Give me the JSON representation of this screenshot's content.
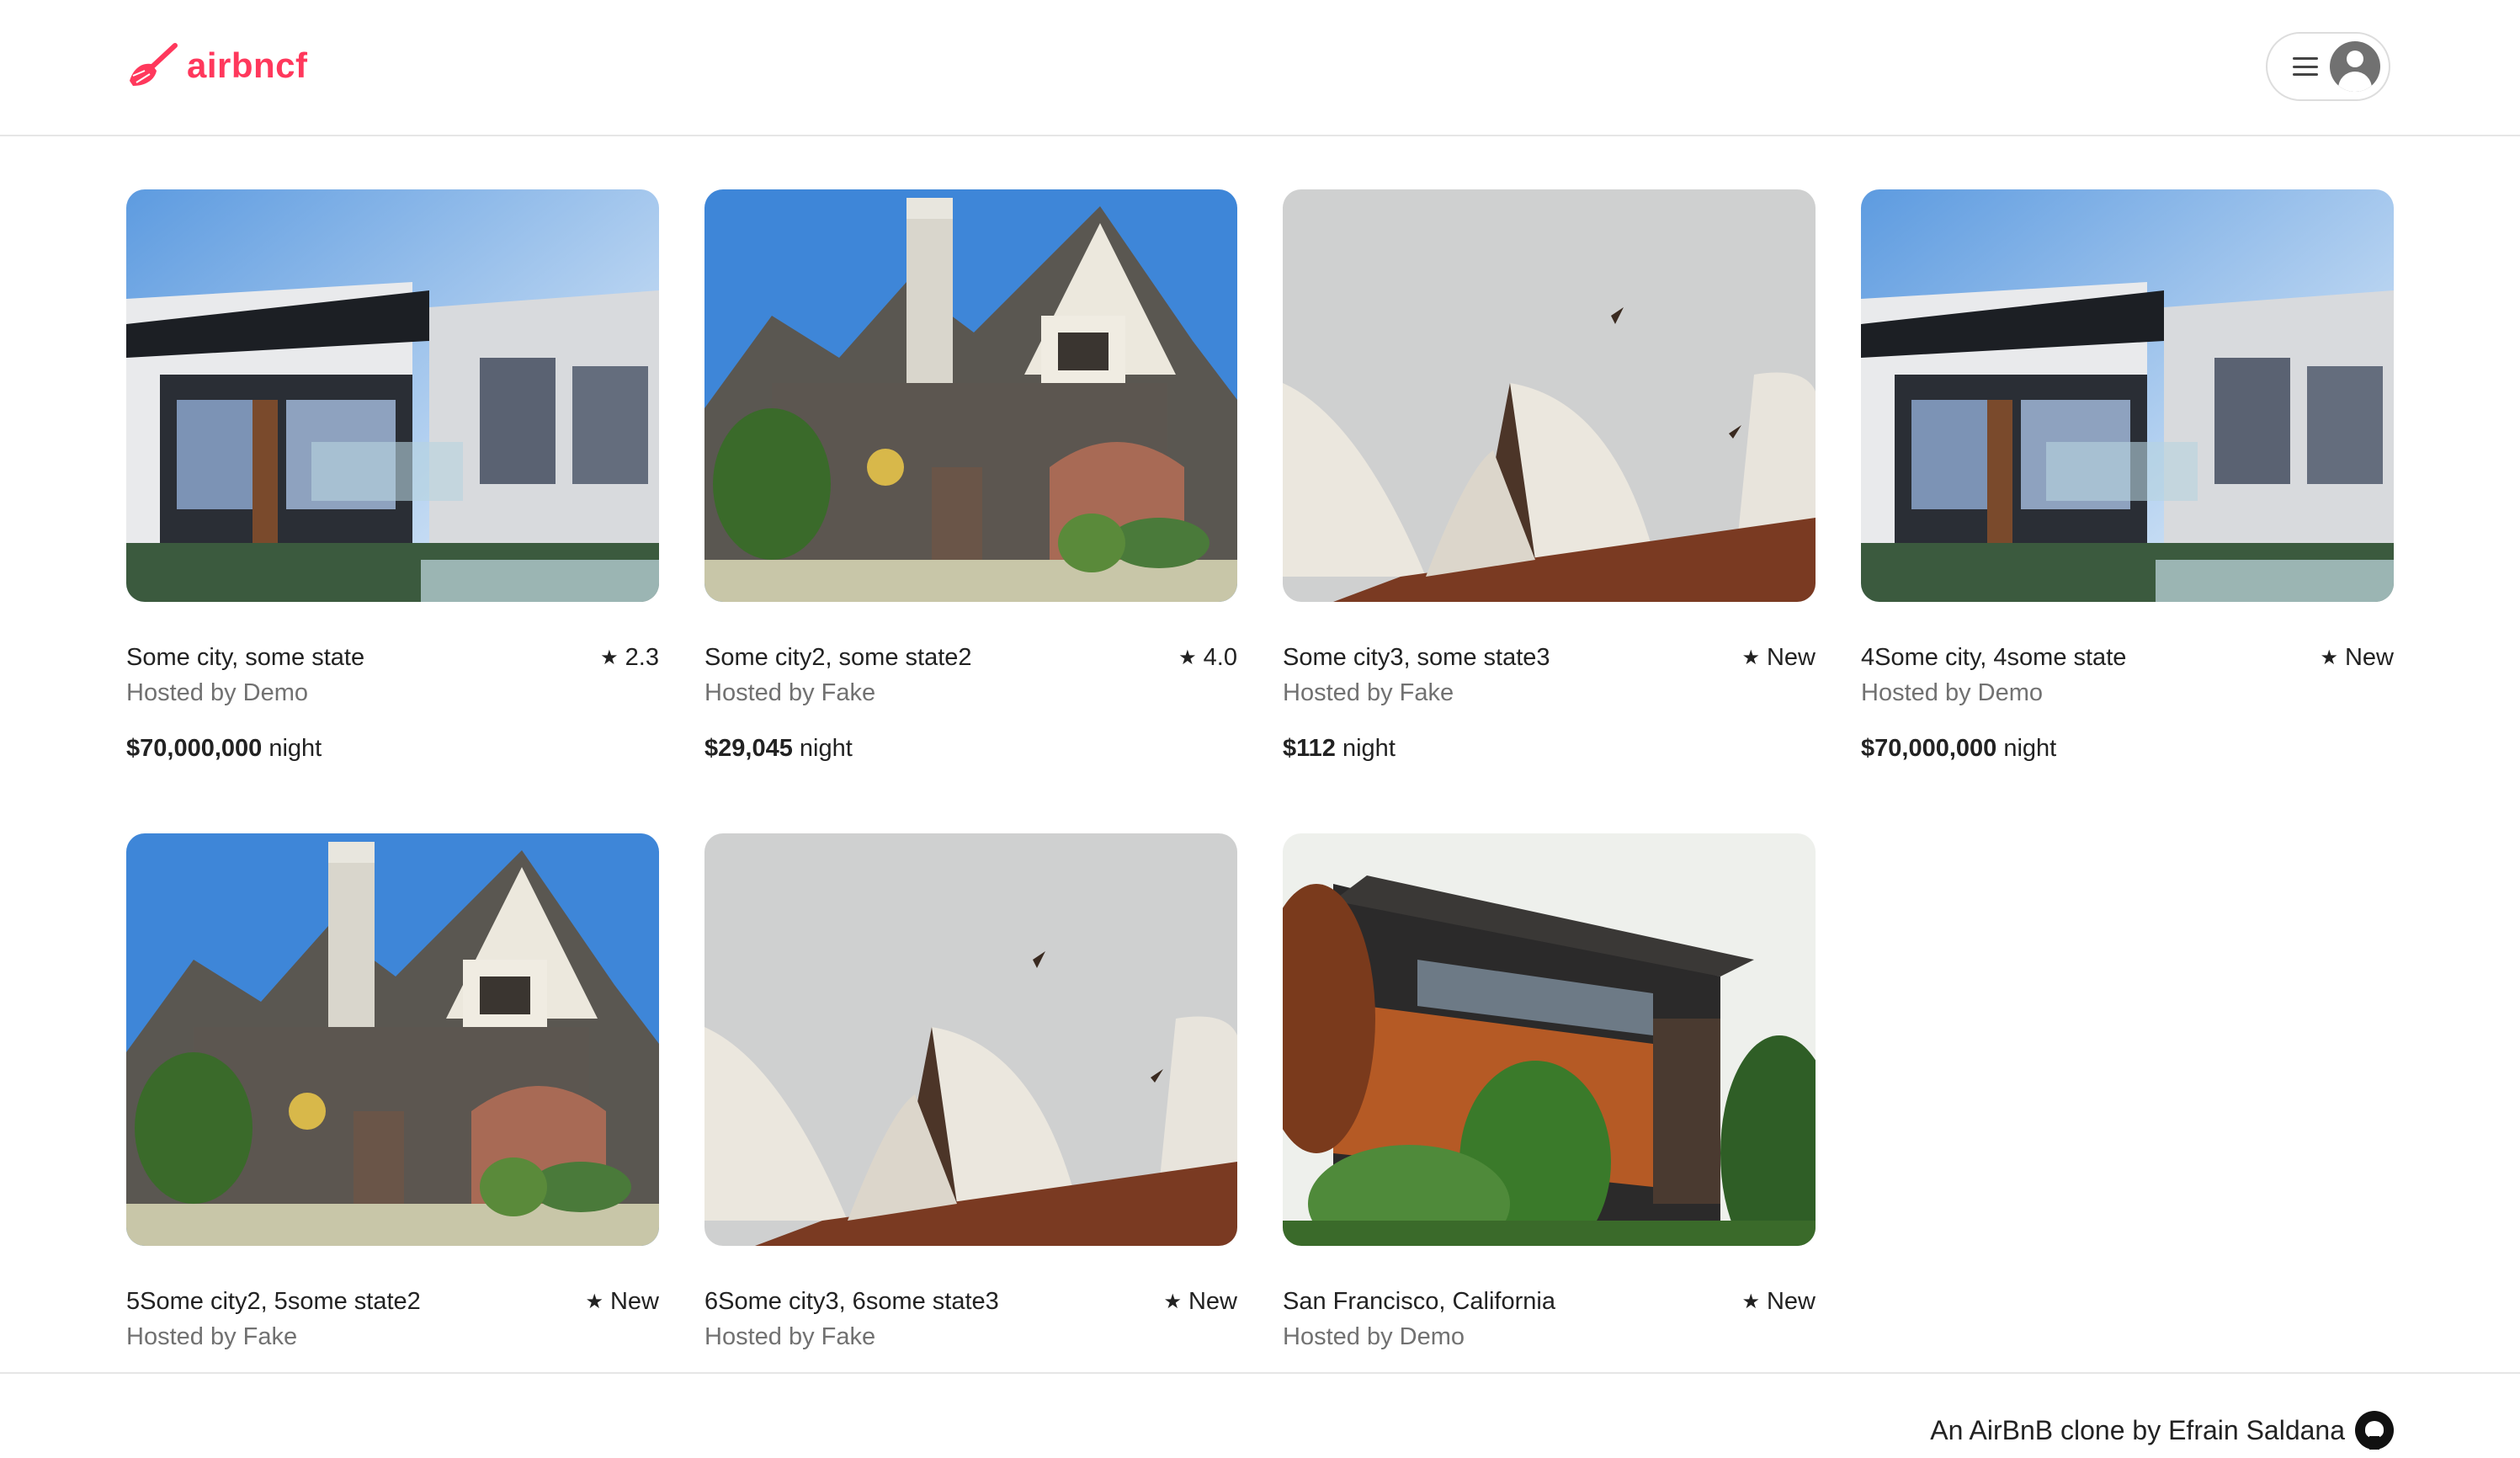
{
  "brand": {
    "name": "airbncf",
    "color": "#ff385c"
  },
  "header": {
    "menu_icon": "hamburger-menu-icon",
    "avatar_icon": "user-avatar-icon"
  },
  "listings": [
    {
      "location": "Some city, some state",
      "rating": "2.3",
      "host": "Hosted by Demo",
      "price": "$70,000,000",
      "price_suffix": "night",
      "photo": "modern-house"
    },
    {
      "location": "Some city2, some state2",
      "rating": "4.0",
      "host": "Hosted by Fake",
      "price": "$29,045",
      "price_suffix": "night",
      "photo": "victorian-house"
    },
    {
      "location": "Some city3, some state3",
      "rating": "New",
      "host": "Hosted by Fake",
      "price": "$112",
      "price_suffix": "night",
      "photo": "opera-house"
    },
    {
      "location": "4Some city, 4some state",
      "rating": "New",
      "host": "Hosted by Demo",
      "price": "$70,000,000",
      "price_suffix": "night",
      "photo": "modern-house"
    },
    {
      "location": "5Some city2, 5some state2",
      "rating": "New",
      "host": "Hosted by Fake",
      "photo": "victorian-house"
    },
    {
      "location": "6Some city3, 6some state3",
      "rating": "New",
      "host": "Hosted by Fake",
      "photo": "opera-house"
    },
    {
      "location": "San Francisco, California",
      "rating": "New",
      "host": "Hosted by Demo",
      "photo": "rust-facade-house"
    }
  ],
  "footer": {
    "credit": "An AirBnB clone by Efrain Saldana",
    "icon": "github-icon"
  }
}
